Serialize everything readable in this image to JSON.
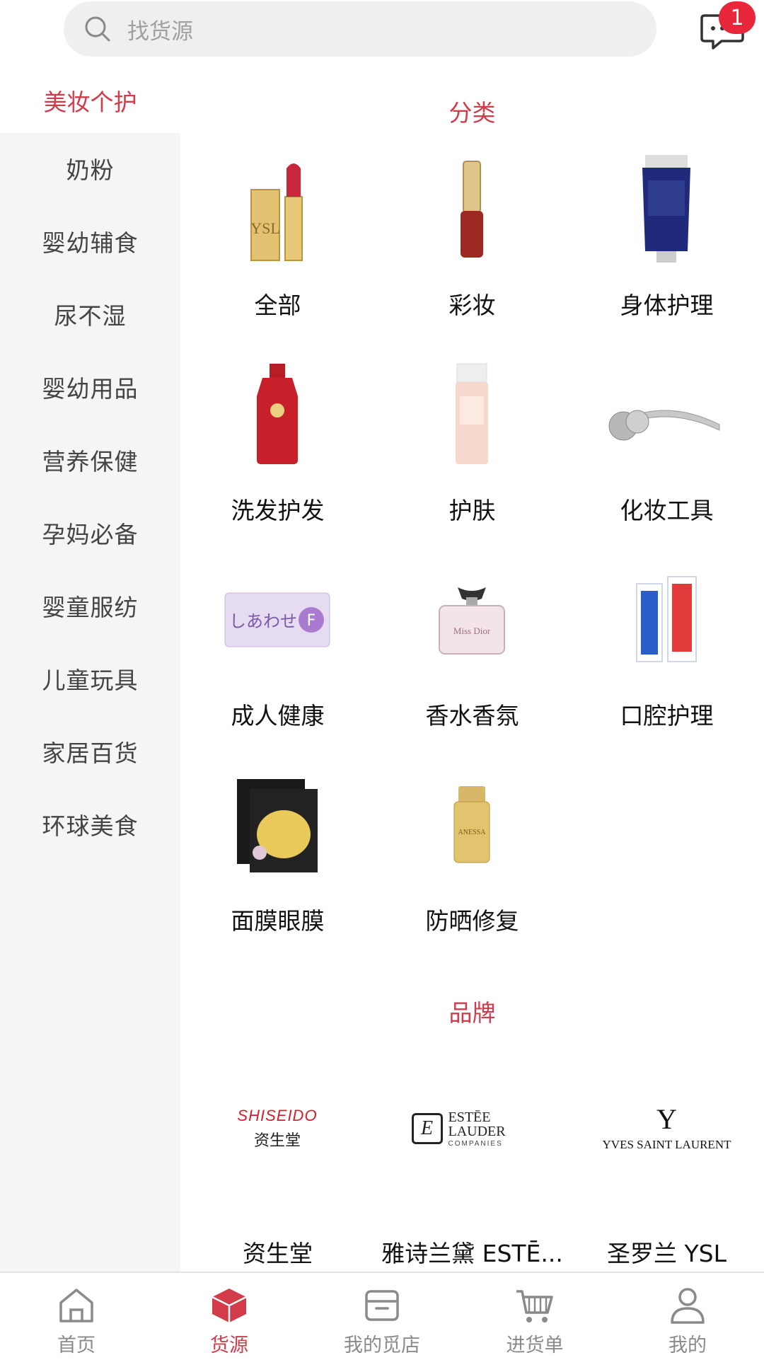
{
  "header": {
    "search_placeholder": "找货源",
    "message_badge": "1"
  },
  "sidebar": {
    "active": "美妆个护",
    "items": [
      "奶粉",
      "婴幼辅食",
      "尿不湿",
      "婴幼用品",
      "营养保健",
      "孕妈必备",
      "婴童服纺",
      "儿童玩具",
      "家居百货",
      "环球美食"
    ]
  },
  "categories": {
    "title": "分类",
    "items": [
      {
        "label": "全部",
        "icon": "lipstick-image"
      },
      {
        "label": "彩妆",
        "icon": "nail-polish-image"
      },
      {
        "label": "身体护理",
        "icon": "cream-tube-image"
      },
      {
        "label": "洗发护发",
        "icon": "shampoo-bottle-image"
      },
      {
        "label": "护肤",
        "icon": "toner-bottle-image"
      },
      {
        "label": "化妆工具",
        "icon": "face-roller-image"
      },
      {
        "label": "成人健康",
        "icon": "sanitary-pack-image"
      },
      {
        "label": "香水香氛",
        "icon": "perfume-bottle-image"
      },
      {
        "label": "口腔护理",
        "icon": "toothpaste-image"
      },
      {
        "label": "面膜眼膜",
        "icon": "face-mask-box-image"
      },
      {
        "label": "防晒修复",
        "icon": "sunscreen-bottle-image"
      }
    ]
  },
  "brands": {
    "title": "品牌",
    "items": [
      {
        "label": "资生堂",
        "logo_en": "SHISEIDO",
        "logo_cn": "资生堂"
      },
      {
        "label": "雅诗兰黛 ESTĒ...",
        "logo_en": "ESTĒE LAUDER",
        "logo_sub": "COMPANIES"
      },
      {
        "label": "圣罗兰 YSL",
        "logo_en": "YVES SAINT LAURENT"
      }
    ]
  },
  "tabbar": {
    "items": [
      {
        "label": "首页",
        "icon": "home-icon"
      },
      {
        "label": "货源",
        "icon": "box-icon"
      },
      {
        "label": "我的觅店",
        "icon": "store-icon"
      },
      {
        "label": "进货单",
        "icon": "cart-icon"
      },
      {
        "label": "我的",
        "icon": "user-icon"
      }
    ],
    "active_color": "#d23c4a"
  },
  "colors": {
    "accent": "#d23c4a",
    "badge": "#e8283a",
    "sidebar_bg": "#f5f5f5"
  }
}
